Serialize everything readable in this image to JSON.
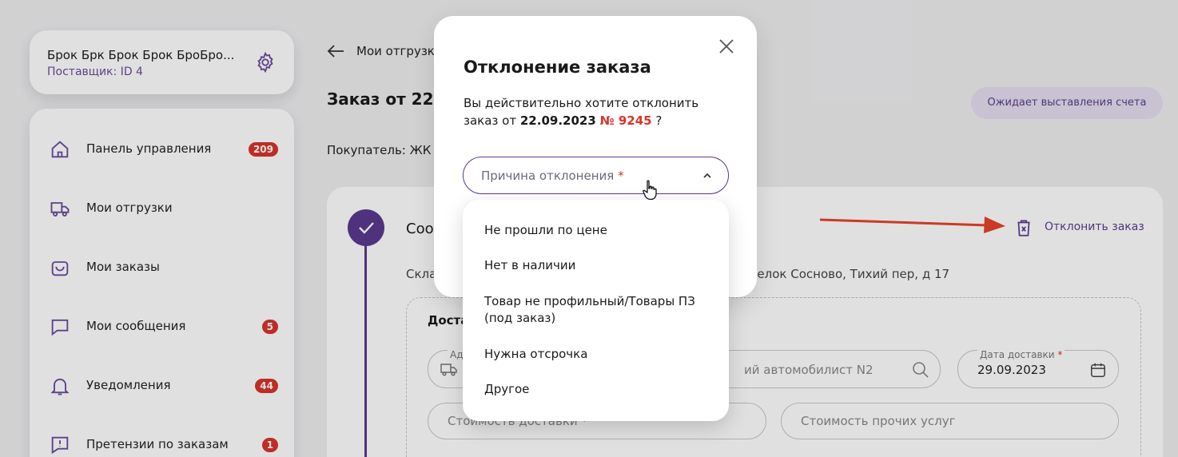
{
  "profile": {
    "name": "Брок Брк Брок Брок БроБро...",
    "subtitle": "Поставщик: ID 4"
  },
  "sidebar": {
    "items": [
      {
        "label": "Панель управления",
        "badge": "209"
      },
      {
        "label": "Мои отгрузки",
        "badge": ""
      },
      {
        "label": "Мои заказы",
        "badge": ""
      },
      {
        "label": "Мои сообщения",
        "badge": "5"
      },
      {
        "label": "Уведомления",
        "badge": "44"
      },
      {
        "label": "Претензии по заказам",
        "badge": "1"
      }
    ]
  },
  "header": {
    "breadcrumb": "Мои отгрузк",
    "order_title": "Заказ от 22.",
    "status": "Ожидает выставления счета",
    "buyer": "Покупатель: ЖК"
  },
  "step": {
    "title": "Соо",
    "warehouse": "Скла",
    "address_tail": "оселок Сосново, Тихий пер, д 17",
    "reject_label": "Отклонить заказ"
  },
  "delivery": {
    "label": "Доста",
    "address_label": "Адре",
    "address_value": "ий автомобилист N2",
    "date_label": "Дата доставки",
    "date_value": "29.09.2023",
    "cost_placeholder": "Стоимость доставки",
    "other_cost_placeholder": "Стоимость прочих услуг"
  },
  "modal": {
    "title": "Отклонение заказа",
    "text_line1": "Вы действительно хотите отклонить",
    "text_prefix": "заказ от",
    "date": "22.09.2023",
    "number": "№ 9245",
    "text_suffix": "?",
    "select_placeholder": "Причина отклонения",
    "required_mark": "*",
    "options": [
      "Не прошли по цене",
      "Нет в наличии",
      "Товар не профильный/Товары ПЗ (под заказ)",
      "Нужна отсрочка",
      "Другое"
    ]
  },
  "colors": {
    "accent": "#5b3a8f",
    "badge": "#d9342b",
    "arrow": "#e8432a",
    "status_bg": "#e4ddef"
  },
  "icons": {
    "profile": "gear-icon",
    "nav": [
      "home-icon",
      "truck-icon",
      "bag-icon",
      "message-icon",
      "bell-icon",
      "claim-icon"
    ],
    "reject": "trash-x-icon",
    "close": "close-icon",
    "select": "chevron-up-icon"
  }
}
